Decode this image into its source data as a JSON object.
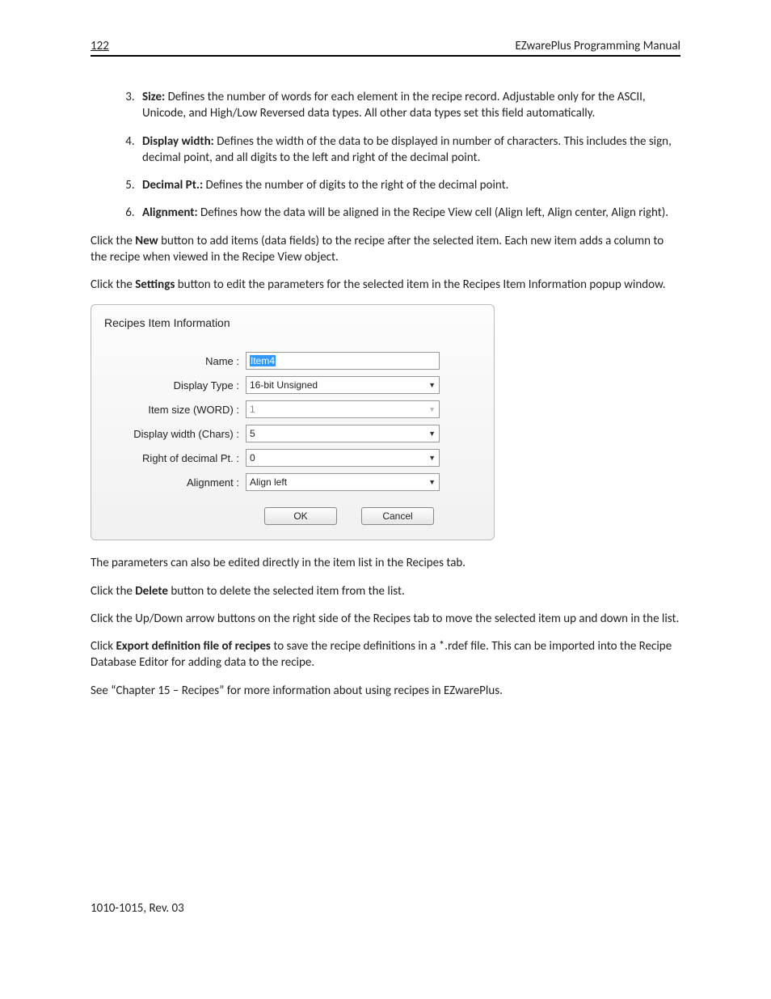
{
  "header": {
    "page_number": "122",
    "title": "EZwarePlus Programming Manual"
  },
  "list": {
    "start": 3,
    "items": [
      {
        "term": "Size:",
        "text": "Defines the number of words for each element in the recipe record. Adjustable only for the ASCII, Unicode, and High/Low Reversed data types. All other data types set this field automatically."
      },
      {
        "term": "Display width:",
        "text": "Defines the width of the data to be displayed in number of characters. This includes the sign, decimal point, and all digits to the left and right of the decimal point."
      },
      {
        "term": "Decimal Pt.:",
        "text": "Defines the number of digits to the right of the decimal point."
      },
      {
        "term": "Alignment:",
        "text": "Defines how the data will be aligned in the Recipe View cell (Align left, Align center, Align right)."
      }
    ]
  },
  "para": {
    "p1a": "Click the ",
    "p1b": "New",
    "p1c": " button to add items (data fields) to the recipe after the selected item. Each new item adds a column to the recipe when viewed in the Recipe View object.",
    "p2a": "Click the ",
    "p2b": "Settings",
    "p2c": " button to edit the parameters for the selected item in the Recipes Item Information popup window.",
    "p3": "The parameters can also be edited directly in the item list in the Recipes tab.",
    "p4a": "Click the ",
    "p4b": "Delete",
    "p4c": " button to delete the selected item from the list.",
    "p5": "Click the Up/Down arrow buttons on the right side of the Recipes tab to move the selected item up and down in the list.",
    "p6a": "Click ",
    "p6b": "Export definition file of recipes",
    "p6c": " to save the recipe definitions in a *.rdef file. This can be imported into the Recipe Database Editor for adding data to the recipe.",
    "p7": "See “Chapter 15 – Recipes” for more information about using recipes in EZwarePlus."
  },
  "dialog": {
    "title": "Recipes Item Information",
    "fields": {
      "name": {
        "label": "Name :",
        "value": "Item4"
      },
      "display_type": {
        "label": "Display Type :",
        "value": "16-bit Unsigned"
      },
      "item_size": {
        "label": "Item size (WORD) :",
        "value": "1"
      },
      "display_width": {
        "label": "Display width (Chars) :",
        "value": "5"
      },
      "decimal_pt": {
        "label": "Right of decimal Pt. :",
        "value": "0"
      },
      "alignment": {
        "label": "Alignment :",
        "value": "Align left"
      }
    },
    "buttons": {
      "ok": "OK",
      "cancel": "Cancel"
    }
  },
  "footer": "1010-1015, Rev. 03"
}
